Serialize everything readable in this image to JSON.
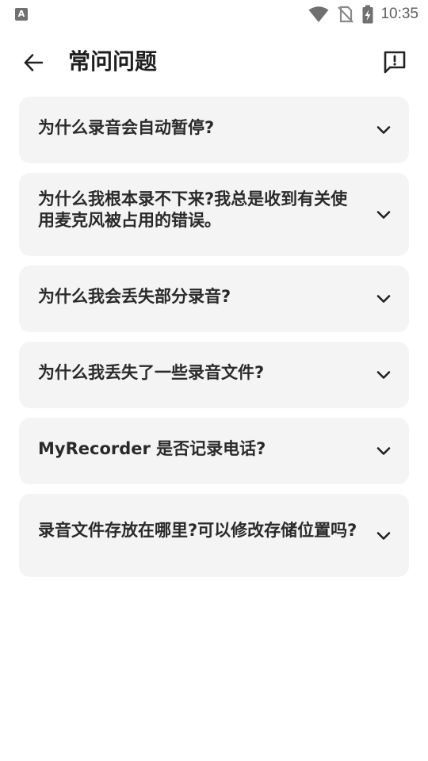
{
  "status_bar": {
    "notification_glyph": "A",
    "time": "10:35",
    "icons": [
      "wifi-icon",
      "no-sim-icon",
      "battery-charging-icon"
    ]
  },
  "header": {
    "title": "常问问题",
    "back_icon": "arrow-left-icon",
    "feedback_icon": "feedback-icon"
  },
  "faq": {
    "items": [
      {
        "question": "为什么录音会自动暂停?",
        "lines": 1
      },
      {
        "question": "为什么我根本录不下来?我总是收到有关使用麦克风被占用的错误。",
        "lines": 2
      },
      {
        "question": "为什么我会丢失部分录音?",
        "lines": 1
      },
      {
        "question": "为什么我丢失了一些录音文件?",
        "lines": 1
      },
      {
        "question": "MyRecorder 是否记录电话?",
        "lines": 1
      },
      {
        "question": "录音文件存放在哪里?可以修改存储位置吗?",
        "lines": 2
      }
    ],
    "chevron_icon": "chevron-down-icon"
  },
  "colors": {
    "card_background": "#f4f4f4",
    "text_primary": "#222222",
    "status_icon": "#707070"
  }
}
